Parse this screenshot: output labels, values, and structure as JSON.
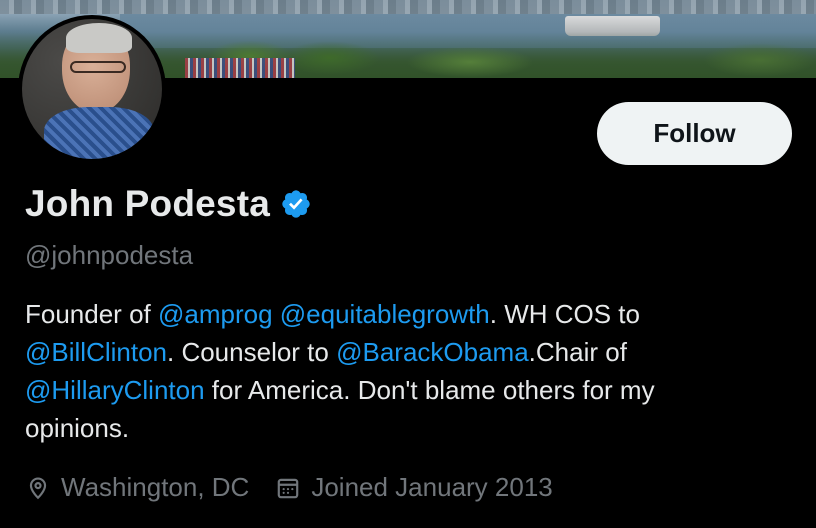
{
  "profile": {
    "display_name": "John Podesta",
    "handle": "@johnpodesta",
    "verified": true,
    "follow_label": "Follow"
  },
  "bio": {
    "lines": [
      [
        {
          "text": "Founder of ",
          "mention": false
        },
        {
          "text": "@amprog",
          "mention": true
        },
        {
          "text": " ",
          "mention": false
        },
        {
          "text": "@equitablegrowth",
          "mention": true
        },
        {
          "text": ". WH COS to",
          "mention": false
        }
      ],
      [
        {
          "text": "@BillClinton",
          "mention": true
        },
        {
          "text": ". Counselor to ",
          "mention": false
        },
        {
          "text": "@BarackObama",
          "mention": true
        },
        {
          "text": ".Chair of",
          "mention": false
        }
      ],
      [
        {
          "text": "@HillaryClinton",
          "mention": true
        },
        {
          "text": " for America. Don't blame others for my",
          "mention": false
        }
      ],
      [
        {
          "text": "opinions.",
          "mention": false
        }
      ]
    ]
  },
  "meta": {
    "location": {
      "icon": "location-pin-icon",
      "text": "Washington, DC"
    },
    "joined": {
      "icon": "calendar-icon",
      "text": "Joined January 2013"
    }
  },
  "colors": {
    "background": "#000000",
    "text_primary": "#e7e9ea",
    "text_secondary": "#71767b",
    "accent": "#1d9bf0",
    "follow_button_bg": "#eff3f4"
  }
}
